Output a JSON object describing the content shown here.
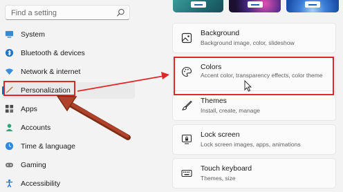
{
  "search": {
    "placeholder": "Find a setting",
    "icon": "search-icon"
  },
  "nav": {
    "items": [
      {
        "label": "System",
        "icon": "display-icon"
      },
      {
        "label": "Bluetooth & devices",
        "icon": "bluetooth-icon"
      },
      {
        "label": "Network & internet",
        "icon": "wifi-icon"
      },
      {
        "label": "Personalization",
        "icon": "brush-icon",
        "active": true
      },
      {
        "label": "Apps",
        "icon": "apps-icon"
      },
      {
        "label": "Accounts",
        "icon": "person-icon"
      },
      {
        "label": "Time & language",
        "icon": "globe-clock-icon"
      },
      {
        "label": "Gaming",
        "icon": "gamepad-icon"
      },
      {
        "label": "Accessibility",
        "icon": "accessibility-icon"
      }
    ]
  },
  "themes": [
    {
      "name": "theme-teal",
      "color": "#2b8a8a"
    },
    {
      "name": "theme-dark-glow",
      "color": "#2a1748"
    },
    {
      "name": "theme-blue-bloom",
      "color": "#3d7fd8"
    }
  ],
  "cards": [
    {
      "title": "Background",
      "subtitle": "Background image, color, slideshow",
      "icon": "image-icon"
    },
    {
      "title": "Colors",
      "subtitle": "Accent color, transparency effects, color theme",
      "icon": "palette-icon"
    },
    {
      "title": "Themes",
      "subtitle": "Install, create, manage",
      "icon": "brush-icon"
    },
    {
      "title": "Lock screen",
      "subtitle": "Lock screen images, apps, animations",
      "icon": "lock-screen-icon"
    },
    {
      "title": "Touch keyboard",
      "subtitle": "Themes, size",
      "icon": "keyboard-icon"
    }
  ],
  "colors": {
    "accent": "#0067c0",
    "annotation": "#e1262a",
    "annotation_arrow": "#b0412a"
  }
}
